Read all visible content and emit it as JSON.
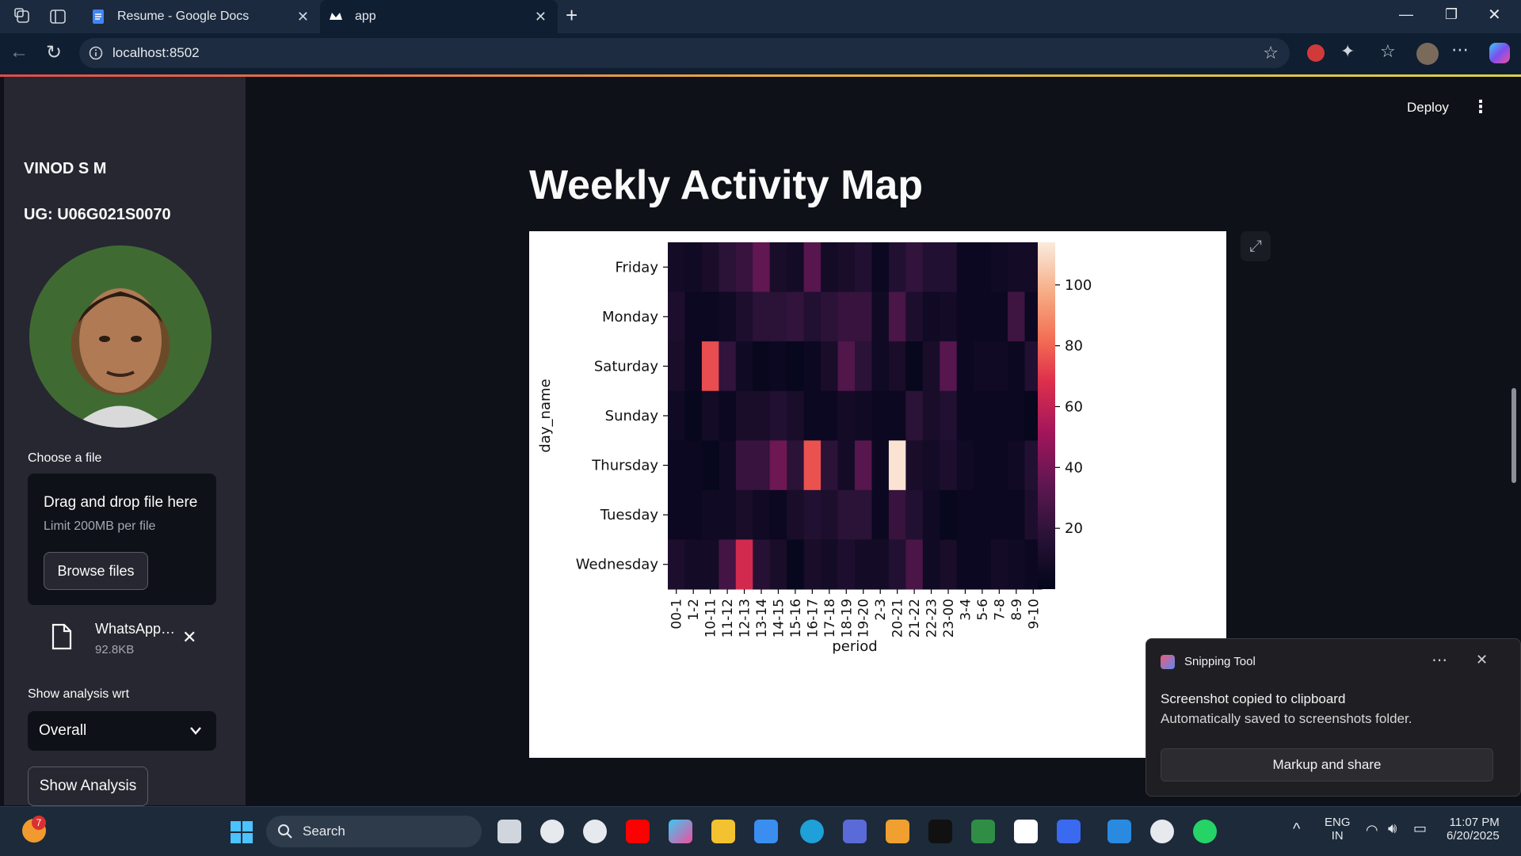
{
  "browser": {
    "tabs": [
      {
        "title": "Resume - Google Docs"
      },
      {
        "title": "app"
      }
    ],
    "url": "localhost:8502"
  },
  "sidebar": {
    "name": "VINOD S M",
    "ug": "UG: U06G021S0070",
    "uploader": {
      "label": "Choose a file",
      "drop_text": "Drag and drop file here",
      "limit_text": "Limit 200MB per file",
      "browse_label": "Browse files",
      "file_name": "WhatsApp…",
      "file_size": "92.8KB"
    },
    "analysis_label": "Show analysis wrt",
    "analysis_value": "Overall",
    "show_button": "Show Analysis"
  },
  "header": {
    "deploy": "Deploy"
  },
  "main": {
    "title": "Weekly Activity Map"
  },
  "chart_data": {
    "type": "heatmap",
    "xlabel": "period",
    "ylabel": "day_name",
    "rows": [
      "Friday",
      "Monday",
      "Saturday",
      "Sunday",
      "Thursday",
      "Tuesday",
      "Wednesday"
    ],
    "columns": [
      "00-1",
      "1-2",
      "10-11",
      "11-12",
      "12-13",
      "13-14",
      "14-15",
      "15-16",
      "16-17",
      "17-18",
      "18-19",
      "19-20",
      "2-3",
      "20-21",
      "21-22",
      "22-23",
      "23-00",
      "3-4",
      "5-6",
      "7-8",
      "8-9",
      "9-10"
    ],
    "values": [
      [
        8,
        6,
        10,
        18,
        22,
        35,
        10,
        8,
        32,
        8,
        10,
        14,
        4,
        14,
        20,
        14,
        14,
        4,
        4,
        6,
        8,
        8
      ],
      [
        12,
        4,
        4,
        6,
        12,
        18,
        18,
        20,
        14,
        18,
        22,
        22,
        6,
        28,
        12,
        6,
        8,
        4,
        4,
        4,
        24,
        4
      ],
      [
        10,
        4,
        75,
        20,
        6,
        2,
        4,
        2,
        4,
        10,
        30,
        18,
        6,
        10,
        2,
        10,
        32,
        4,
        6,
        6,
        4,
        14
      ],
      [
        6,
        2,
        8,
        4,
        10,
        10,
        14,
        10,
        4,
        4,
        8,
        6,
        4,
        4,
        18,
        10,
        14,
        4,
        4,
        4,
        4,
        2
      ],
      [
        4,
        4,
        2,
        6,
        22,
        22,
        38,
        18,
        76,
        18,
        8,
        32,
        4,
        112,
        10,
        8,
        12,
        6,
        4,
        4,
        6,
        14
      ],
      [
        4,
        4,
        6,
        6,
        10,
        6,
        4,
        10,
        14,
        12,
        18,
        18,
        4,
        22,
        14,
        6,
        2,
        4,
        4,
        4,
        4,
        12
      ],
      [
        12,
        8,
        8,
        26,
        65,
        16,
        10,
        2,
        10,
        8,
        12,
        8,
        8,
        14,
        28,
        6,
        10,
        4,
        4,
        8,
        6,
        4
      ]
    ],
    "colorbar": {
      "ticks": [
        20,
        40,
        60,
        80,
        100
      ],
      "min": 0,
      "max": 114,
      "colormap": "rocket"
    }
  },
  "notification": {
    "app": "Snipping Tool",
    "title": "Screenshot copied to clipboard",
    "body": "Automatically saved to screenshots folder.",
    "action": "Markup and share"
  },
  "taskbar": {
    "search": "Search",
    "lang_top": "ENG",
    "lang_bottom": "IN",
    "time": "11:07 PM",
    "date": "6/20/2025",
    "weather_badge": "7"
  }
}
